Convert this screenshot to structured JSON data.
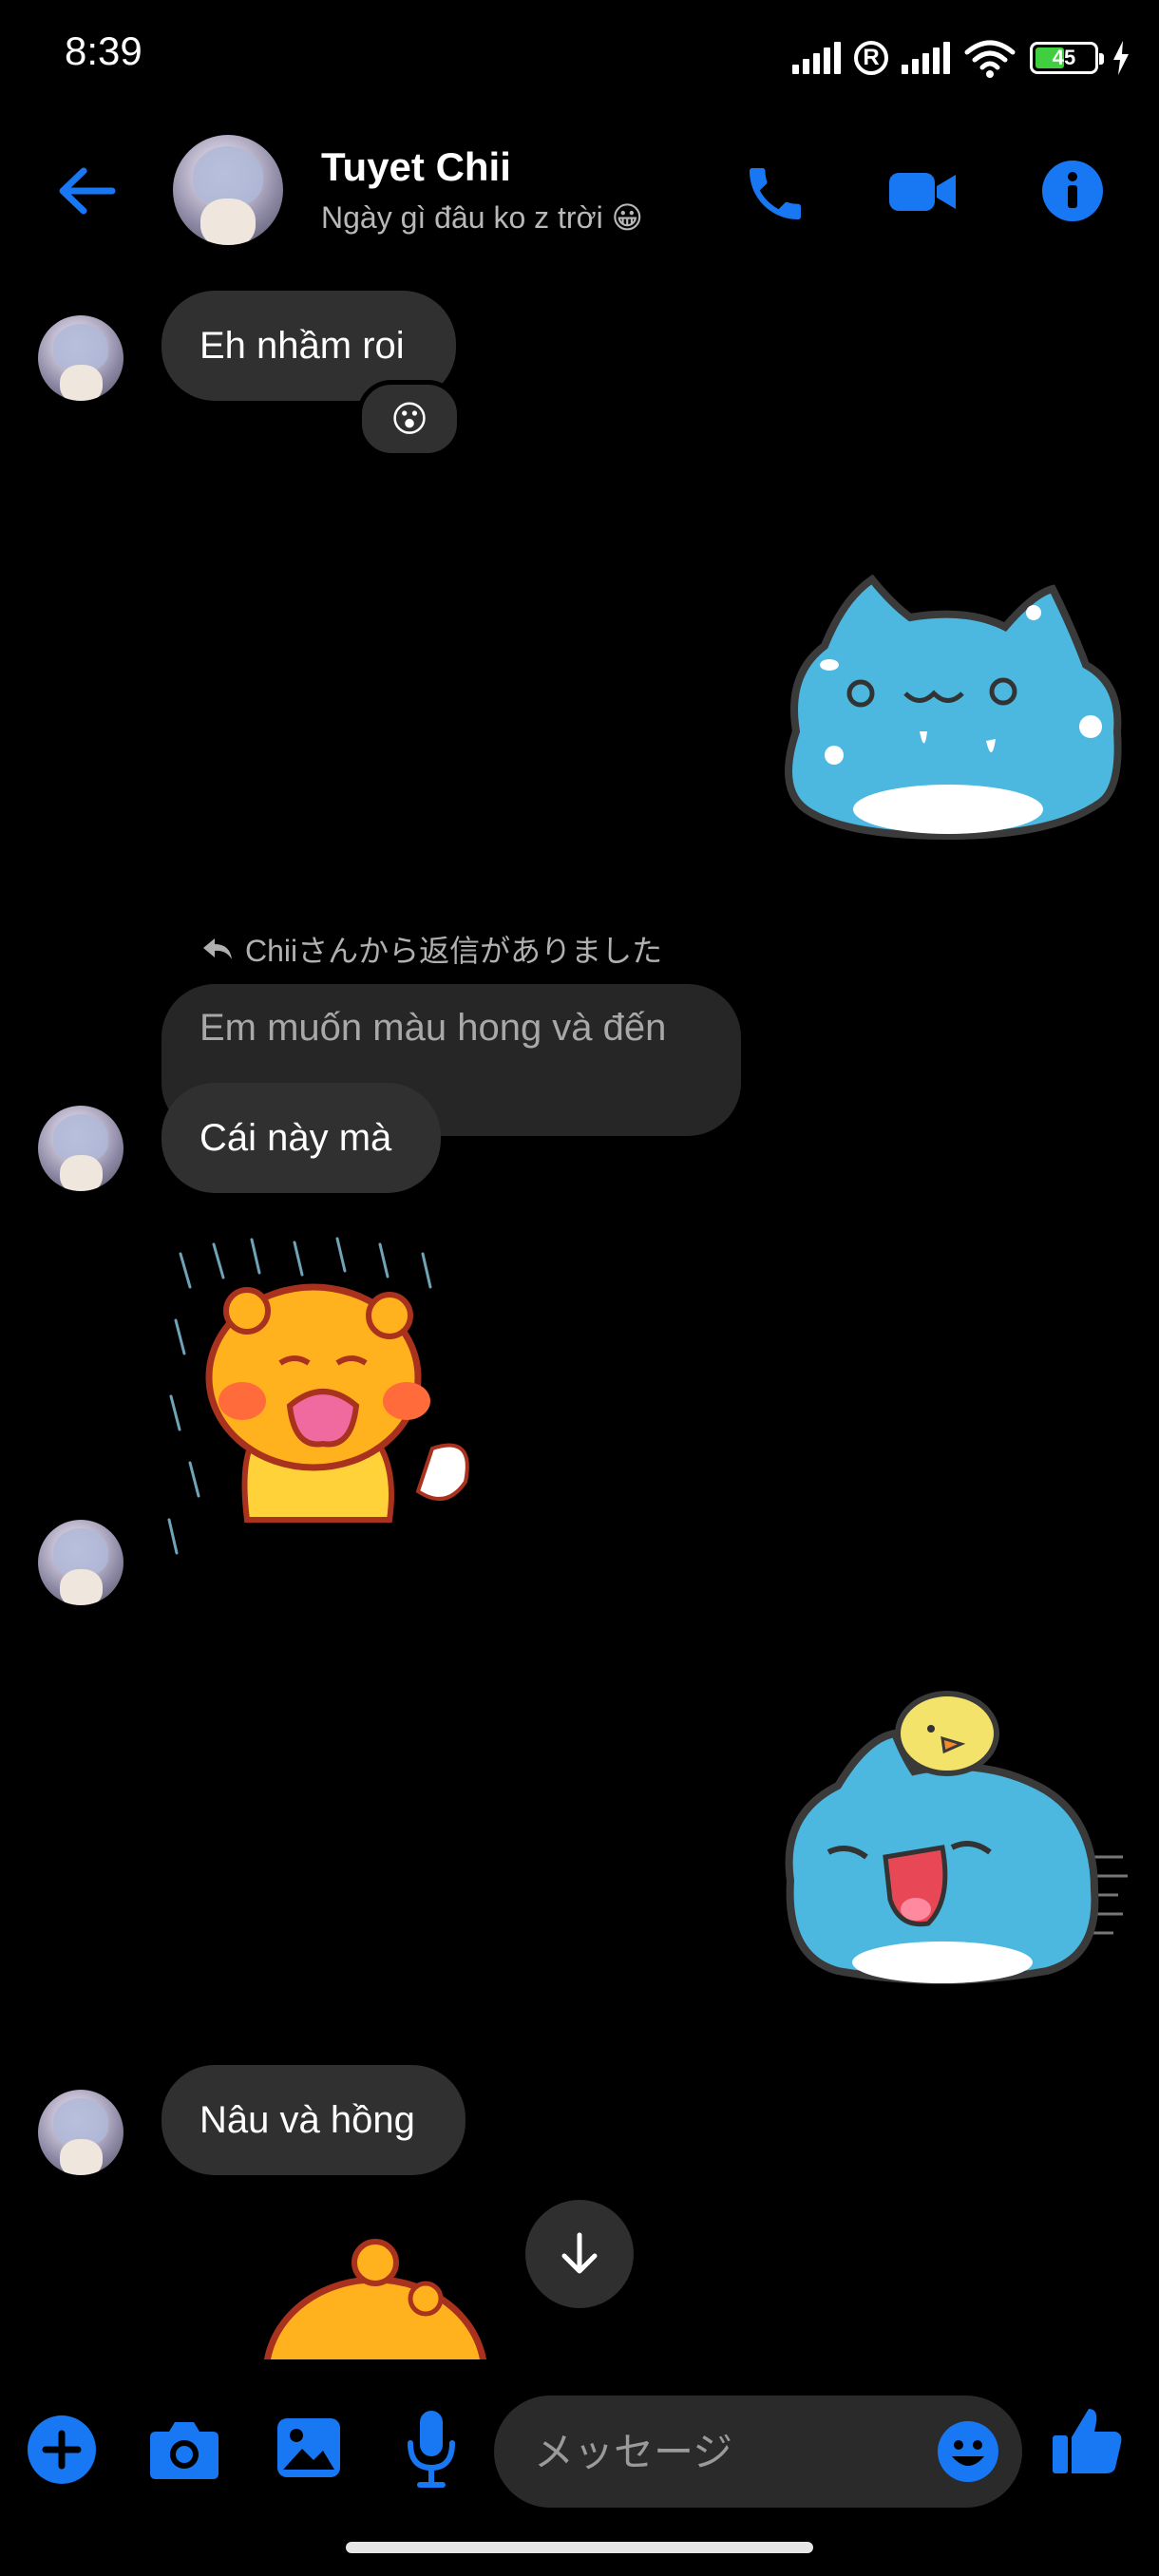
{
  "status_bar": {
    "time": "8:39",
    "battery": "45"
  },
  "header": {
    "name": "Tuyet Chii",
    "status": "Ngày gì đâu ko z trời 😀",
    "accent": "#1877f2"
  },
  "messages": {
    "m1": {
      "text": "Eh nhầm roi",
      "reaction": "😮"
    },
    "reply": {
      "label": "Chiiさんから返信がありました",
      "quoted": "Em muốn màu hong và đến",
      "text": "Cái này mà"
    },
    "m3": {
      "text": "Nâu và hồng"
    }
  },
  "composer": {
    "placeholder": "メッセージ"
  }
}
